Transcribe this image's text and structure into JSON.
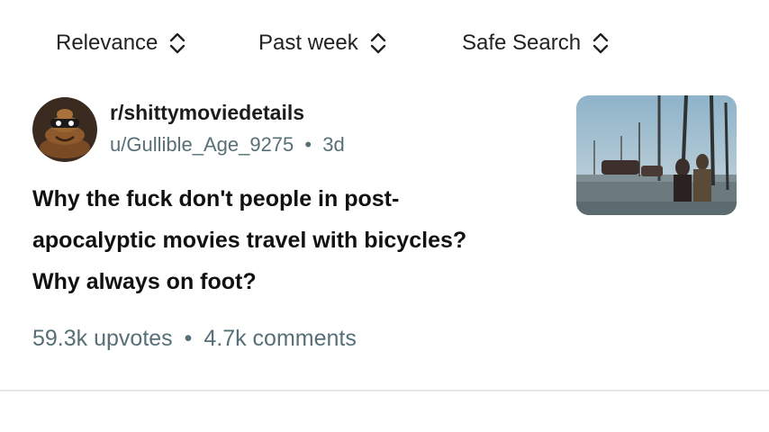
{
  "filters": {
    "sort": {
      "label": "Relevance",
      "icon": "up-down-chevron-icon"
    },
    "time": {
      "label": "Past week",
      "icon": "up-down-chevron-icon"
    },
    "safe_search": {
      "label": "Safe Search",
      "icon": "up-down-chevron-icon"
    }
  },
  "post": {
    "subreddit": "r/shittymoviedetails",
    "author": "u/Gullible_Age_9275",
    "separator": "•",
    "age": "3d",
    "title": "Why the fuck don't people in post-apocalyptic movies travel with bicycles? Why always on foot?",
    "upvotes": "59.3k upvotes",
    "comments": "4.7k comments"
  },
  "colors": {
    "meta_text": "#576f76",
    "divider": "#e5e5e5"
  }
}
